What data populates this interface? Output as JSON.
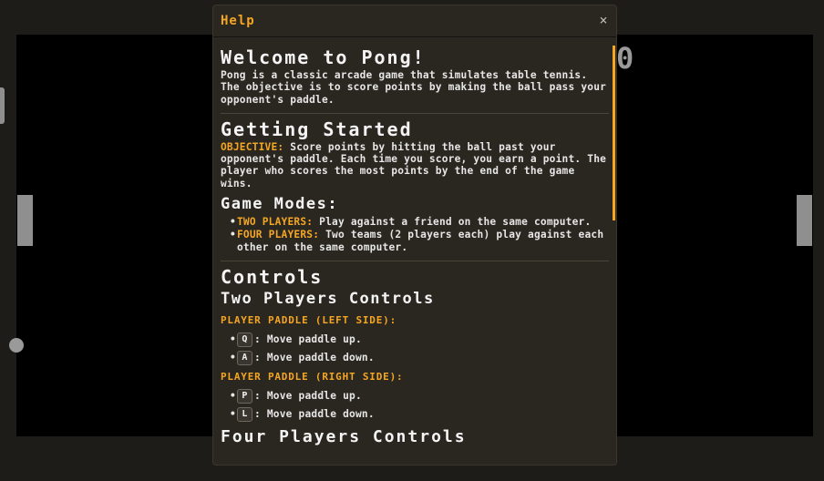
{
  "game": {
    "score_right": "0"
  },
  "modal": {
    "title": "Help",
    "close_label": "×",
    "welcome": {
      "heading": "Welcome to Pong!",
      "text": "Pong is a classic arcade game that simulates table tennis. The objective is to score points by making the ball pass your opponent's paddle."
    },
    "getting_started": {
      "heading": "Getting Started",
      "objective_label": "OBJECTIVE:",
      "objective_text": " Score points by hitting the ball past your opponent's paddle. Each time you score, you earn a point. The player who scores the most points by the end of the game wins.",
      "modes_heading": "Game Modes:",
      "modes": [
        {
          "label": "TWO PLAYERS:",
          "text": " Play against a friend on the same computer."
        },
        {
          "label": "FOUR PLAYERS:",
          "text": " Two teams (2 players each) play against each other on the same computer."
        }
      ]
    },
    "controls": {
      "heading": "Controls",
      "two_players_heading": "Two Players Controls",
      "left_label": "PLAYER PADDLE (LEFT SIDE):",
      "left_keys": [
        {
          "key": "Q",
          "action": ": Move paddle up."
        },
        {
          "key": "A",
          "action": ": Move paddle down."
        }
      ],
      "right_label": "PLAYER PADDLE (RIGHT SIDE):",
      "right_keys": [
        {
          "key": "P",
          "action": ": Move paddle up."
        },
        {
          "key": "L",
          "action": ": Move paddle down."
        }
      ],
      "four_players_heading": "Four Players Controls"
    }
  }
}
